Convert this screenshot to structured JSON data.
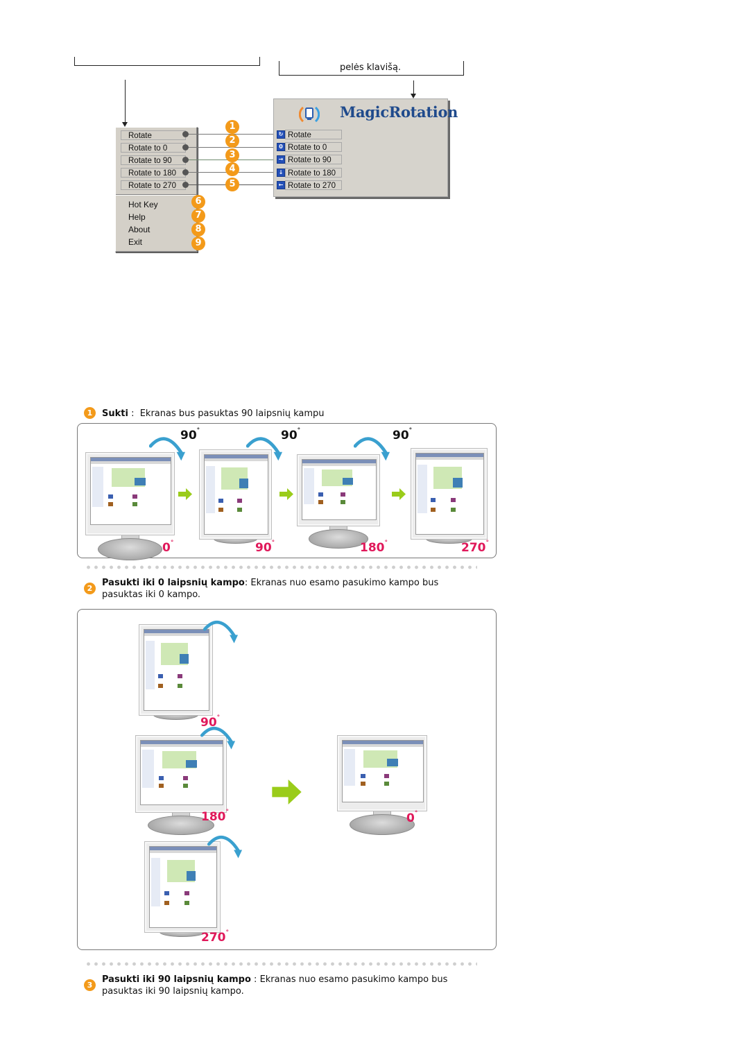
{
  "callouts": {
    "left_text": "",
    "right_text": "pelės klavišą."
  },
  "context_menu": {
    "rotate_buttons": [
      {
        "label": "Rotate",
        "badge": "1"
      },
      {
        "label": "Rotate to 0",
        "badge": "2"
      },
      {
        "label": "Rotate to 90",
        "badge": "3"
      },
      {
        "label": "Rotate to 180",
        "badge": "4"
      },
      {
        "label": "Rotate to 270",
        "badge": "5"
      }
    ],
    "items": [
      {
        "label": "Hot Key",
        "badge": "6"
      },
      {
        "label": "Help",
        "badge": "7"
      },
      {
        "label": "About",
        "badge": "8"
      },
      {
        "label": "Exit",
        "badge": "9"
      }
    ]
  },
  "magic_rotation": {
    "title": "MagicRotation",
    "buttons": [
      {
        "label": "Rotate",
        "icon": "rotate-icon",
        "glyph": "↻"
      },
      {
        "label": "Rotate to 0",
        "icon": "rotate-0-icon",
        "glyph": "0"
      },
      {
        "label": "Rotate to 90",
        "icon": "rotate-90-icon",
        "glyph": "→"
      },
      {
        "label": "Rotate to 180",
        "icon": "rotate-180-icon",
        "glyph": "↓"
      },
      {
        "label": "Rotate to 270",
        "icon": "rotate-270-icon",
        "glyph": "←"
      }
    ]
  },
  "sections": [
    {
      "badge": "1",
      "title": "Sukti",
      "separator": " :  ",
      "text": "Ekranas bus pasuktas 90 laipsnių kampu",
      "continuation": ""
    },
    {
      "badge": "2",
      "title": "Pasukti iki 0 laipsnių kampo",
      "separator": ": ",
      "text": "Ekranas nuo esamo pasukimo kampo bus",
      "continuation": "pasuktas iki 0 kampo."
    },
    {
      "badge": "3",
      "title": "Pasukti iki 90 laipsnių kampo",
      "separator": " : ",
      "text": "Ekranas nuo esamo pasukimo kampo bus",
      "continuation": "pasuktas iki 90 laipsnių kampo."
    }
  ],
  "panel1": {
    "step_labels": [
      "90",
      "90",
      "90"
    ],
    "monitor_labels": [
      "0",
      "90",
      "180",
      "270"
    ],
    "degree_symbol": "°"
  },
  "panel2": {
    "source_labels": [
      "90",
      "180",
      "270"
    ],
    "target_label": "0",
    "degree_symbol": "°"
  },
  "colors": {
    "badge": "#f39a1a",
    "degree_label": "#e0185a",
    "arc": "#3aa0cf",
    "arrow": "#9acc1a",
    "title_blue": "#1f4a8c",
    "menu_bg": "#d4d0c8"
  }
}
